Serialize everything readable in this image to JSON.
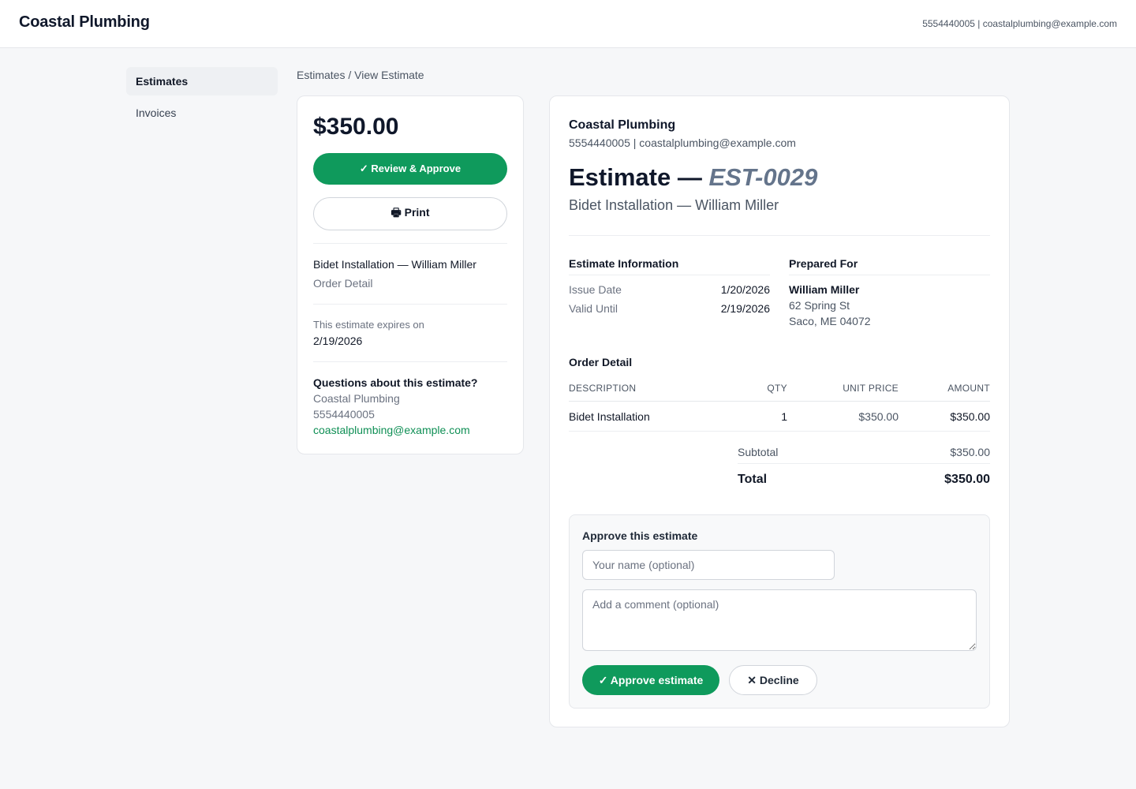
{
  "header": {
    "brand": "Coastal Plumbing",
    "contact": "5554440005 | coastalplumbing@example.com"
  },
  "sidebar": {
    "items": [
      {
        "label": "Estimates",
        "active": true
      },
      {
        "label": "Invoices",
        "active": false
      }
    ]
  },
  "breadcrumb": "Estimates / View Estimate",
  "summary": {
    "amount": "$350.00",
    "review_button": "✓ Review & Approve",
    "print_button": "🖶 Print",
    "job_title": "Bidet Installation — William Miller",
    "order_detail_label": "Order Detail",
    "expires_text": "This estimate expires on",
    "expires_date": "2/19/2026",
    "questions_title": "Questions about this estimate?",
    "company": "Coastal Plumbing",
    "phone": "5554440005",
    "email": "coastalplumbing@example.com"
  },
  "estimate": {
    "company": "Coastal Plumbing",
    "contact": "5554440005 | coastalplumbing@example.com",
    "heading_prefix": "Estimate — ",
    "number": "EST-0029",
    "subtitle": "Bidet Installation — William Miller",
    "info": {
      "title": "Estimate Information",
      "issue_label": "Issue Date",
      "issue_value": "1/20/2026",
      "valid_label": "Valid Until",
      "valid_value": "2/19/2026"
    },
    "prepared_for": {
      "title": "Prepared For",
      "name": "William Miller",
      "street": "62 Spring St",
      "city": "Saco, ME 04072"
    },
    "order": {
      "title": "Order Detail",
      "headers": [
        "DESCRIPTION",
        "QTY",
        "UNIT PRICE",
        "AMOUNT"
      ],
      "rows": [
        {
          "description": "Bidet Installation",
          "qty": "1",
          "unit_price": "$350.00",
          "amount": "$350.00"
        }
      ],
      "subtotal_label": "Subtotal",
      "subtotal_value": "$350.00",
      "total_label": "Total",
      "total_value": "$350.00"
    },
    "approve": {
      "title": "Approve this estimate",
      "name_placeholder": "Your name (optional)",
      "comment_placeholder": "Add a comment (optional)",
      "approve_button": "✓ Approve estimate",
      "decline_button": "✕ Decline"
    }
  },
  "colors": {
    "accent": "#0f9a5c",
    "link": "#0f8f55",
    "background": "#f6f7f9"
  }
}
